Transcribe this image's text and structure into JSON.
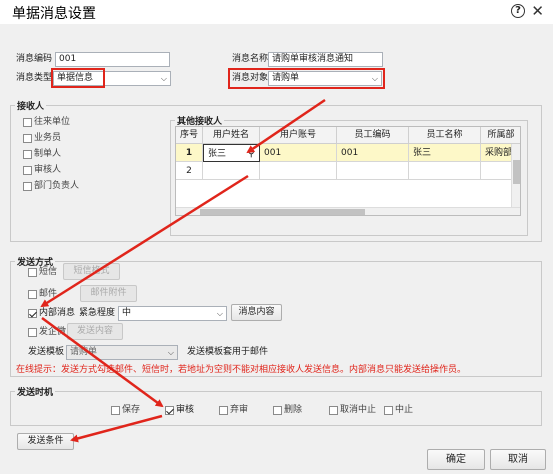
{
  "window": {
    "title": "单据消息设置",
    "help_glyph": "?",
    "close_glyph": "✕"
  },
  "basic": {
    "code_label": "消息编码",
    "code_value": "001",
    "name_label": "消息名称",
    "name_value": "请购单审核消息通知",
    "type_label": "消息类型",
    "type_value": "单据信息",
    "target_label": "消息对象",
    "target_value": "请购单"
  },
  "receivers": {
    "title": "接收人",
    "options": [
      {
        "label": "往来单位",
        "checked": false
      },
      {
        "label": "业务员",
        "checked": false
      },
      {
        "label": "制单人",
        "checked": false
      },
      {
        "label": "审核人",
        "checked": false
      },
      {
        "label": "部门负责人",
        "checked": false
      }
    ],
    "other_title": "其他接收人",
    "columns": [
      "序号",
      "用户姓名",
      "用户账号",
      "员工编码",
      "员工名称",
      "所属部"
    ],
    "rows": [
      {
        "no": "1",
        "user_name": "张三",
        "account": "001",
        "emp_code": "001",
        "emp_name": "张三",
        "dept": "采购部"
      },
      {
        "no": "2",
        "user_name": "",
        "account": "",
        "emp_code": "",
        "emp_name": "",
        "dept": ""
      }
    ]
  },
  "send_method": {
    "title": "发送方式",
    "sms_label": "短信",
    "sms_button": "短信格式",
    "mail_label": "邮件",
    "mail_button": "邮件附件",
    "internal_label": "内部消息",
    "urgency_label": "紧急程度",
    "urgency_value": "中",
    "content_button": "消息内容",
    "wechat_label": "发企微",
    "wechat_button": "发送内容",
    "template_label": "发送模板",
    "template_value": "请购单",
    "template_note": "发送模板套用于邮件",
    "hint": "在线提示：发送方式勾选邮件、短信时，若地址为空则不能对相应接收人发送信息。内部消息只能发送给操作员。"
  },
  "send_time": {
    "title": "发送时机",
    "options": [
      {
        "label": "保存",
        "checked": false
      },
      {
        "label": "审核",
        "checked": true
      },
      {
        "label": "弃审",
        "checked": false
      },
      {
        "label": "删除",
        "checked": false
      },
      {
        "label": "取消中止",
        "checked": false
      },
      {
        "label": "中止",
        "checked": false
      }
    ]
  },
  "footer": {
    "condition_button": "发送条件",
    "ok_button": "确定",
    "cancel_button": "取消"
  },
  "colors": {
    "annotation_red": "#e0251b",
    "selected_row": "#fdf8c8",
    "dialog_bg": "#f0f0f0"
  }
}
